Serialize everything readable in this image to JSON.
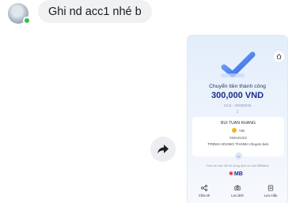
{
  "chat": {
    "message": "Ghi nd acc1 nhé b",
    "sender_status_color": "#2fbf4e",
    "avatar_icon": "user-avatar"
  },
  "forward_icon": "share-forward-icon",
  "receipt": {
    "title": "Chuyển tiền thành công",
    "amount": "300,000 VND",
    "datetime": "13:11 - 04/09/2026",
    "recipient_name": "BUI TUAN KHANG",
    "bank": "VIB",
    "account_number": "096545252",
    "memo": "TRINH HOANG THANH chuyen tien",
    "thanks": "Cảm ơn bạn đã sử dụng dịch vụ của MBBank",
    "logo_text": "MB",
    "actions": [
      {
        "label": "Chia sẻ",
        "icon": "share-icon"
      },
      {
        "label": "Lưu ảnh",
        "icon": "camera-icon"
      },
      {
        "label": "Lưu mẫu",
        "icon": "save-template-icon"
      }
    ],
    "accent_color": "#1b2b8f"
  }
}
